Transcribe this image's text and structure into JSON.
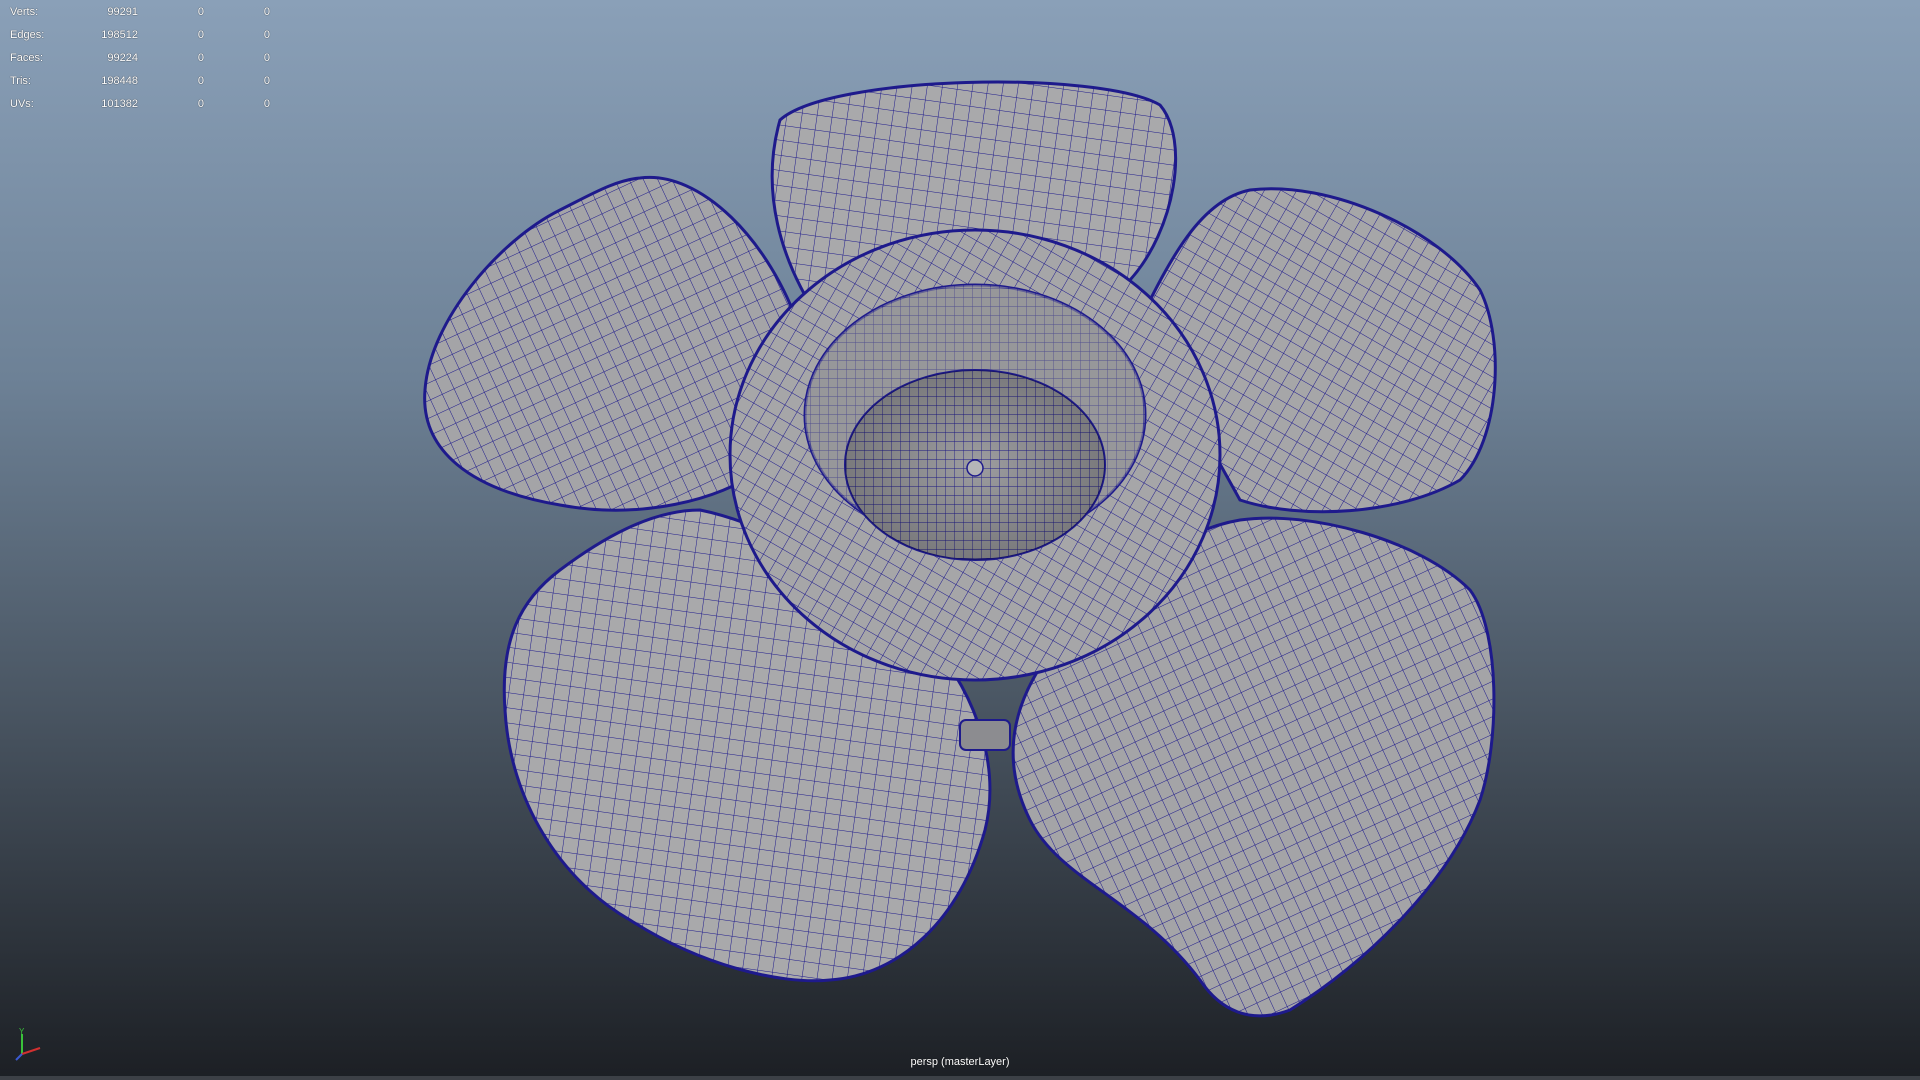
{
  "hud": {
    "rows": [
      {
        "label": "Verts:",
        "v1": "99291",
        "v2": "0",
        "v3": "0"
      },
      {
        "label": "Edges:",
        "v1": "198512",
        "v2": "0",
        "v3": "0"
      },
      {
        "label": "Faces:",
        "v1": "99224",
        "v2": "0",
        "v3": "0"
      },
      {
        "label": "Tris:",
        "v1": "198448",
        "v2": "0",
        "v3": "0"
      },
      {
        "label": "UVs:",
        "v1": "101382",
        "v2": "0",
        "v3": "0"
      }
    ]
  },
  "viewport": {
    "camera_label": "persp (masterLayer)",
    "object": "flower-mesh",
    "wire_color": "#1e1a8c",
    "surface_color": "#a9a9ab"
  },
  "axis": {
    "y_label": "Y"
  },
  "colors": {
    "axis_x": "#d23030",
    "axis_y": "#3ac23a",
    "axis_z": "#3a5ad2"
  }
}
